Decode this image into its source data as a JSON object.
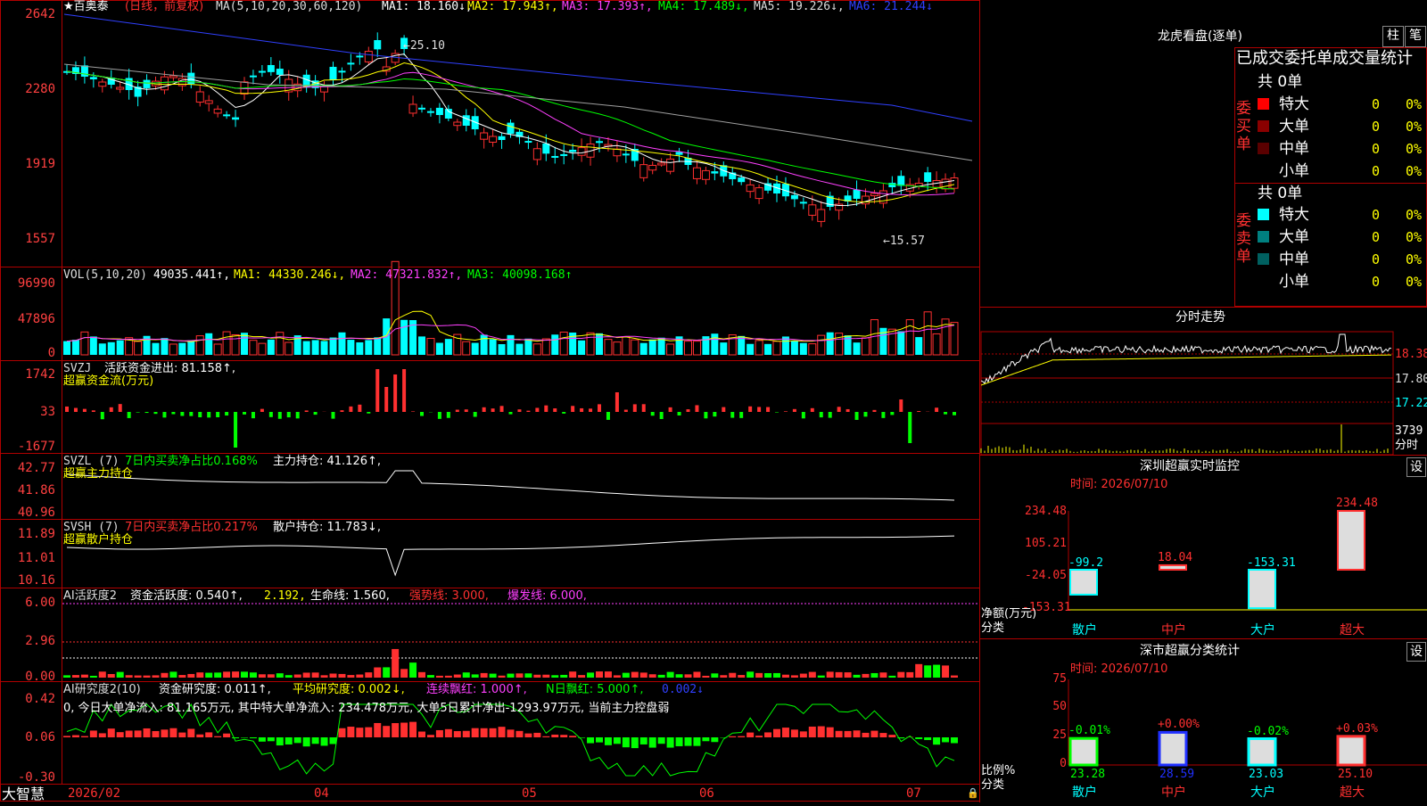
{
  "colors": {
    "up": "#ff3030",
    "down": "#00ffff",
    "grid": "#b00000",
    "text": "#dddddd",
    "yellow": "#ffff00",
    "green": "#00ff00",
    "magenta": "#ff40ff",
    "blue": "#3040ff",
    "white": "#ffffff",
    "gray": "#a0a0a0"
  },
  "main": {
    "stock_name": "★百奥泰",
    "period": "(日线，前复权)",
    "ma_label": "MA(5,10,20,30,60,120)",
    "ma1": "MA1: 18.160↓,",
    "ma2": "MA2: 17.943↑,",
    "ma3": "MA3: 17.393↑,",
    "ma4": "MA4: 17.489↓,",
    "ma5": "MA5: 19.226↓,",
    "ma6": "MA6: 21.244↓",
    "axis": [
      "2642",
      "2280",
      "1919",
      "1557"
    ],
    "high_marker": "25.10",
    "low_marker": "15.57"
  },
  "vol": {
    "label": "VOL(5,10,20)",
    "value": "49035.441↑,",
    "ma1": "MA1: 44330.246↓,",
    "ma2": "MA2: 47321.832↑,",
    "ma3": "MA3: 40098.168↑",
    "axis": [
      "96990",
      "47896",
      "0"
    ]
  },
  "svzj": {
    "label": "SVZJ",
    "text": "活跃资金进出: 81.158↑,",
    "sub": "超赢资金流(万元)",
    "axis": [
      "1742",
      "33",
      "-1677"
    ]
  },
  "svzl": {
    "label": "SVZL (7)",
    "t1": "7日内买卖净占比0.168%",
    "t2": "主力持仓: 41.126↑,",
    "sub": "超赢主力持仓",
    "axis": [
      "42.77",
      "41.86",
      "40.96"
    ]
  },
  "svsh": {
    "label": "SVSH (7)",
    "t1": "7日内买卖净占比0.217%",
    "t2": "散户持仓: 11.783↓,",
    "sub": "超赢散户持仓",
    "axis": [
      "11.89",
      "11.01",
      "10.16"
    ]
  },
  "ai1": {
    "label": "AI活跃度2",
    "t1": "资金活跃度: 0.540↑,",
    "t2": "2.192,",
    "t3": "生命线: 1.560,",
    "t4": "强势线: 3.000,",
    "t5": "爆发线: 6.000,",
    "axis": [
      "6.00",
      "2.96",
      "0.00"
    ]
  },
  "ai2": {
    "label": "AI研究度2(10)",
    "t1": "资金研究度: 0.011↑,",
    "t2": "平均研究度: 0.002↓,",
    "t3": "连续飘红: 1.000↑,",
    "t4": "N日飘红: 5.000↑,",
    "t5": "0.002↓",
    "note": "0, 今日大单净流入: 81.165万元, 其中特大单净流入: 234.478万元, 大单5日累计净出-1293.97万元, 当前主力控盘弱",
    "axis": [
      "0.42",
      "0.06",
      "-0.30"
    ]
  },
  "xaxis": {
    "brand": "大智慧",
    "dates": [
      "2026/02",
      "04",
      "05",
      "06",
      "07"
    ]
  },
  "longhu": {
    "title": "龙虎看盘(逐单)",
    "btn1": "柱",
    "btn2": "笔",
    "subtitle": "已成交委托单成交量统计",
    "buy": {
      "side": "委买单",
      "total": "共 0单",
      "rows": [
        {
          "name": "特大",
          "v": "0",
          "p": "0%"
        },
        {
          "name": "大单",
          "v": "0",
          "p": "0%"
        },
        {
          "name": "中单",
          "v": "0",
          "p": "0%"
        },
        {
          "name": "小单",
          "v": "0",
          "p": "0%"
        }
      ]
    },
    "sell": {
      "side": "委卖单",
      "total": "共 0单",
      "rows": [
        {
          "name": "特大",
          "v": "0",
          "p": "0%"
        },
        {
          "name": "大单",
          "v": "0",
          "p": "0%"
        },
        {
          "name": "中单",
          "v": "0",
          "p": "0%"
        },
        {
          "name": "小单",
          "v": "0",
          "p": "0%"
        }
      ]
    }
  },
  "fenshi": {
    "title": "分时走势",
    "axis": [
      "18.38",
      "17.80",
      "17.22"
    ],
    "vol": "3739",
    "vol_unit": "分时"
  },
  "monitor": {
    "title": "深圳超赢实时监控",
    "btn": "设",
    "time": "时间: 2026/07/10",
    "axis": [
      "234.48",
      "105.21",
      "-24.05",
      "-153.31"
    ],
    "unit": "净额(万元)",
    "cat_label": "分类",
    "bars": [
      {
        "cat": "散户",
        "value": -99.2,
        "label": "-99.2"
      },
      {
        "cat": "中户",
        "value": 18.04,
        "label": "18.04"
      },
      {
        "cat": "大户",
        "value": -153.31,
        "label": "-153.31"
      },
      {
        "cat": "超大",
        "value": 234.48,
        "label": "234.48"
      }
    ]
  },
  "stats": {
    "title": "深市超赢分类统计",
    "btn": "设",
    "time": "时间: 2026/07/10",
    "axis": [
      "75",
      "50",
      "25",
      "0"
    ],
    "unit": "比例%",
    "cat_label": "分类",
    "bars": [
      {
        "cat": "散户",
        "value": 23.28,
        "change": "-0.01%",
        "label": "23.28"
      },
      {
        "cat": "中户",
        "value": 28.59,
        "change": "+0.00%",
        "label": "28.59"
      },
      {
        "cat": "大户",
        "value": 23.03,
        "change": "-0.02%",
        "label": "23.03"
      },
      {
        "cat": "超大",
        "value": 25.1,
        "change": "+0.03%",
        "label": "25.10"
      }
    ]
  }
}
